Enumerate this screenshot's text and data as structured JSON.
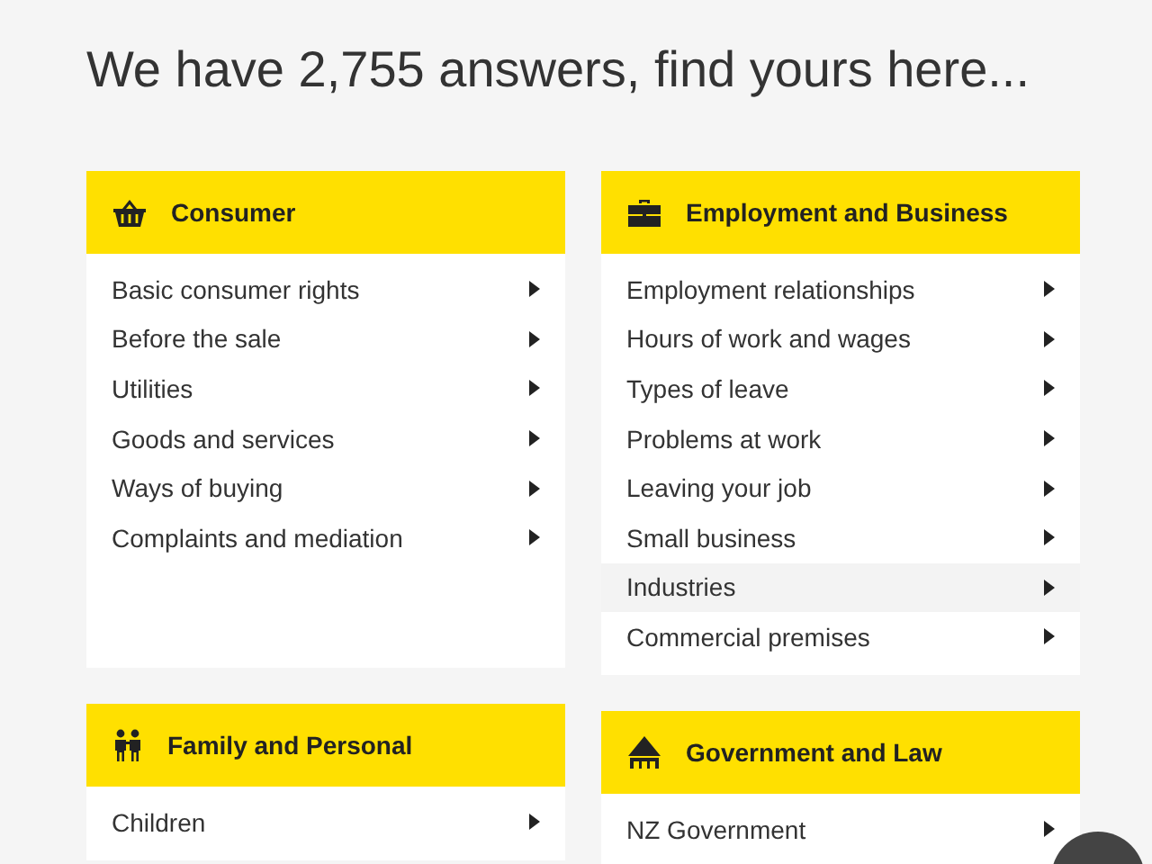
{
  "heading": "We have 2,755 answers, find yours here...",
  "columns": [
    {
      "categories": [
        {
          "title": "Consumer",
          "items": [
            {
              "label": "Basic consumer rights",
              "selected": false
            },
            {
              "label": "Before the sale",
              "selected": false
            },
            {
              "label": "Utilities",
              "selected": false
            },
            {
              "label": "Goods and services",
              "selected": false
            },
            {
              "label": "Ways of buying",
              "selected": false
            },
            {
              "label": "Complaints and mediation",
              "selected": false
            }
          ]
        },
        {
          "title": "Family and Personal",
          "items": [
            {
              "label": "Children",
              "selected": false
            }
          ]
        }
      ]
    },
    {
      "categories": [
        {
          "title": "Employment and Business",
          "items": [
            {
              "label": "Employment relationships",
              "selected": false
            },
            {
              "label": "Hours of work and wages",
              "selected": false
            },
            {
              "label": "Types of leave",
              "selected": false
            },
            {
              "label": "Problems at work",
              "selected": false
            },
            {
              "label": "Leaving your job",
              "selected": false
            },
            {
              "label": "Small business",
              "selected": false
            },
            {
              "label": "Industries",
              "selected": true
            },
            {
              "label": "Commercial premises",
              "selected": false
            }
          ]
        },
        {
          "title": "Government and Law",
          "items": [
            {
              "label": "NZ Government",
              "selected": false
            }
          ]
        }
      ]
    }
  ]
}
